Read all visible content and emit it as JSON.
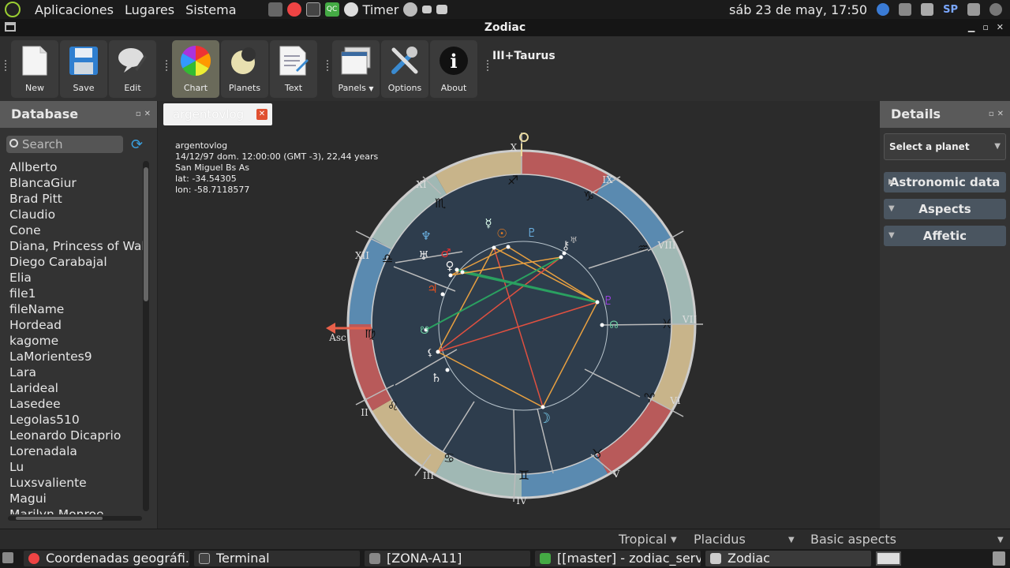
{
  "system_bar": {
    "menus": [
      "Aplicaciones",
      "Lugares",
      "Sistema"
    ],
    "timer_label": "Timer",
    "clock": "sáb 23 de may, 17:50",
    "lang": "SP"
  },
  "window": {
    "title": "Zodiac"
  },
  "toolbar": {
    "buttons": [
      {
        "label": "New",
        "icon": "new-document-icon"
      },
      {
        "label": "Save",
        "icon": "floppy-save-icon"
      },
      {
        "label": "Edit",
        "icon": "edit-pen-icon"
      },
      {
        "label": "Chart",
        "icon": "color-wheel-icon"
      },
      {
        "label": "Planets",
        "icon": "planet-icon"
      },
      {
        "label": "Text",
        "icon": "text-document-icon"
      },
      {
        "label": "Panels",
        "icon": "panels-icon"
      },
      {
        "label": "Options",
        "icon": "tools-icon"
      },
      {
        "label": "About",
        "icon": "info-icon"
      }
    ],
    "selected_label": "III+Taurus"
  },
  "database": {
    "title": "Database",
    "search_placeholder": "Search",
    "items": [
      "Allberto",
      "BlancaGiur",
      "Brad Pitt",
      "Claudio",
      "Cone",
      "Diana, Princess of Wale",
      "Diego Carabajal",
      "Elia",
      "file1",
      "fileName",
      "Hordead",
      "kagome",
      "LaMorientes9",
      "Lara",
      "Larideal",
      "Lasedee",
      "Legolas510",
      "Leonardo Dicaprio",
      "Lorenadala",
      "Lu",
      "Luxsvaliente",
      "Magui",
      "Marilyn Monroe"
    ]
  },
  "chart": {
    "tab_label": "argentovlog",
    "info": {
      "name": "argentovlog",
      "date": "14/12/97 dom. 12:00:00 (GMT -3), 22,44 years",
      "place": "San Miguel Bs As",
      "lat": "lat: -34.54305",
      "lon": "lon: -58.7118577"
    },
    "house_labels": [
      "X",
      "IX",
      "VIII",
      "VII",
      "VI",
      "V",
      "IV",
      "III",
      "II",
      "XI",
      "XII"
    ],
    "asc_label": "Asc"
  },
  "details": {
    "title": "Details",
    "select_placeholder": "Select a planet",
    "sections": [
      "Astronomic data",
      "Aspects",
      "Affetic"
    ]
  },
  "statusbar": {
    "zodiac": "Tropical",
    "houses": "Placidus",
    "aspects": "Basic aspects"
  },
  "taskbar": {
    "tasks": [
      "Coordenadas geográfi...",
      "Terminal",
      "[ZONA-A11]",
      "[[master] - zodiac_serv...",
      "Zodiac"
    ]
  }
}
